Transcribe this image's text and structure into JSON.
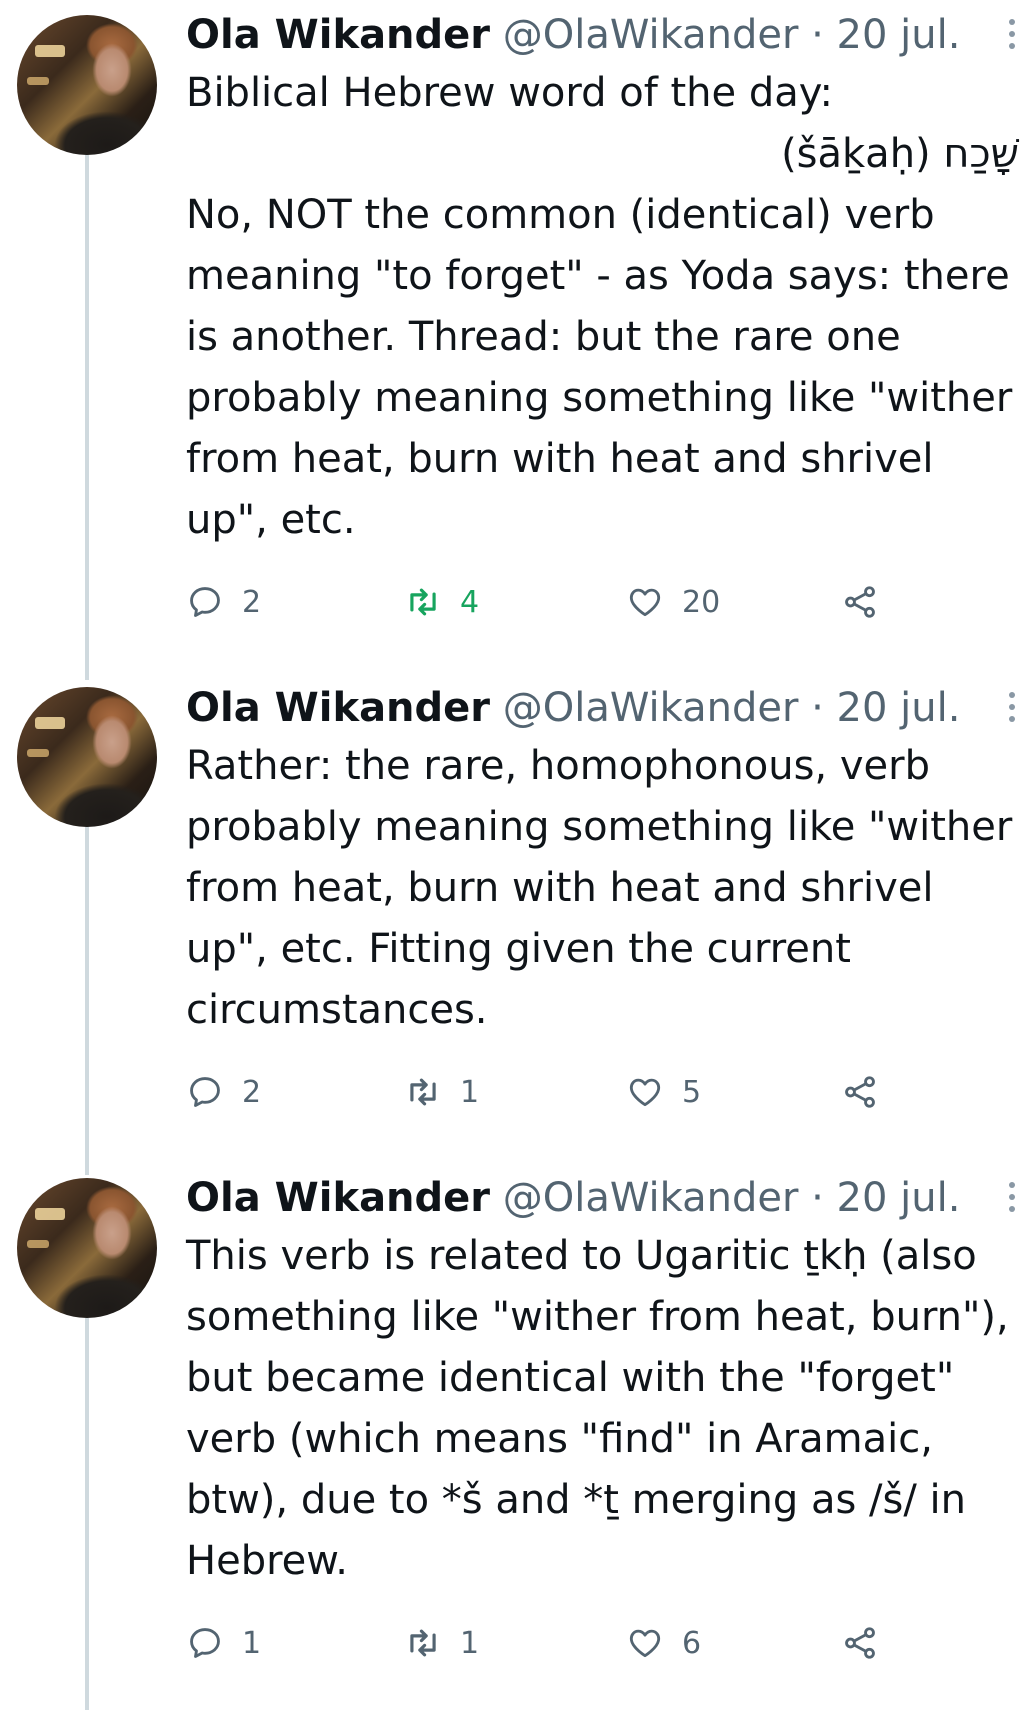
{
  "tweets": [
    {
      "name": "Ola Wikander",
      "handle": "@OlaWikander · 20 jul.",
      "lines": [
        "Biblical Hebrew word of the day:",
        "(šāḵaḥ) שָׁכַח",
        "No, NOT the common (identical) verb",
        "meaning \"to forget\" - as Yoda says: there",
        "is another. Thread:  but the rare one",
        "probably meaning something like \"wither",
        "from heat, burn with heat and shrivel",
        "up\", etc."
      ],
      "replies": "2",
      "retweets": "4",
      "likes": "20",
      "retweeted": true
    },
    {
      "name": "Ola Wikander",
      "handle": "@OlaWikander · 20 jul.",
      "lines": [
        "Rather: the rare, homophonous, verb",
        "probably meaning something like \"wither",
        "from heat, burn with heat and shrivel",
        "up\", etc. Fitting given the current",
        "circumstances."
      ],
      "replies": "2",
      "retweets": "1",
      "likes": "5",
      "retweeted": false
    },
    {
      "name": "Ola Wikander",
      "handle": "@OlaWikander · 20 jul.",
      "lines": [
        "This verb is related to Ugaritic ṯkḥ (also",
        "something like \"wither from heat, burn\"),",
        "but became identical with the \"forget\"",
        "verb (which means \"find\" in Aramaic,",
        "btw), due to *š and *ṯ merging as /š/ in",
        "Hebrew."
      ],
      "replies": "1",
      "retweets": "1",
      "likes": "6",
      "retweeted": false
    }
  ],
  "icons": {
    "reply": "reply-icon",
    "retweet": "retweet-icon",
    "like": "heart-icon",
    "share": "share-icon",
    "more": "more-icon"
  },
  "colors": {
    "text": "#0f1419",
    "secondary": "#536471",
    "retweet_active": "#17a45e",
    "thread_line": "#cfd9de"
  }
}
